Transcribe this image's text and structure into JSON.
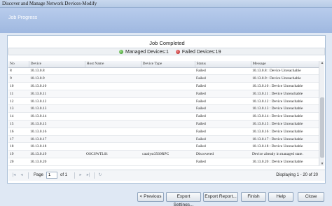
{
  "window": {
    "title": "Discover and Manage Network Devices-Modify"
  },
  "header": {
    "title": "Job Progress"
  },
  "job": {
    "status": "Job Completed",
    "managed_label": "Managed Devices:1",
    "failed_label": "Failed Devices:19",
    "colors": {
      "managed": "#2d8a1e",
      "failed": "#b01818"
    }
  },
  "grid": {
    "columns": [
      "No",
      "Device",
      "Host Name",
      "Device Type",
      "Status",
      "Message"
    ],
    "rows": [
      {
        "no": "8",
        "device": "10.13.0.8",
        "host": "",
        "type": "",
        "status": "Failed",
        "message": "10.13.0.8 : Device Unreachable"
      },
      {
        "no": "9",
        "device": "10.13.0.9",
        "host": "",
        "type": "",
        "status": "Failed",
        "message": "10.13.0.9 : Device Unreachable"
      },
      {
        "no": "10",
        "device": "10.13.0.10",
        "host": "",
        "type": "",
        "status": "Failed",
        "message": "10.13.0.10 : Device Unreachable"
      },
      {
        "no": "11",
        "device": "10.13.0.11",
        "host": "",
        "type": "",
        "status": "Failed",
        "message": "10.13.0.11 : Device Unreachable"
      },
      {
        "no": "12",
        "device": "10.13.0.12",
        "host": "",
        "type": "",
        "status": "Failed",
        "message": "10.13.0.12 : Device Unreachable"
      },
      {
        "no": "13",
        "device": "10.13.0.13",
        "host": "",
        "type": "",
        "status": "Failed",
        "message": "10.13.0.13 : Device Unreachable"
      },
      {
        "no": "14",
        "device": "10.13.0.14",
        "host": "",
        "type": "",
        "status": "Failed",
        "message": "10.13.0.14 : Device Unreachable"
      },
      {
        "no": "15",
        "device": "10.13.0.15",
        "host": "",
        "type": "",
        "status": "Failed",
        "message": "10.13.0.15 : Device Unreachable"
      },
      {
        "no": "16",
        "device": "10.13.0.16",
        "host": "",
        "type": "",
        "status": "Failed",
        "message": "10.13.0.16 : Device Unreachable"
      },
      {
        "no": "17",
        "device": "10.13.0.17",
        "host": "",
        "type": "",
        "status": "Failed",
        "message": "10.13.0.17 : Device Unreachable"
      },
      {
        "no": "18",
        "device": "10.13.0.18",
        "host": "",
        "type": "",
        "status": "Failed",
        "message": "10.13.0.18 : Device Unreachable"
      },
      {
        "no": "19",
        "device": "10.13.0.19",
        "host": "OSCSWTL01",
        "type": "catalyst3560RPC",
        "status": "Discovered",
        "message": "Device already in managed state."
      },
      {
        "no": "20",
        "device": "10.13.0.20",
        "host": "",
        "type": "",
        "status": "Failed",
        "message": "10.13.0.20 : Device Unreachable"
      }
    ]
  },
  "pager": {
    "first_icon": "first-page-icon",
    "prev_icon": "prev-page-icon",
    "next_icon": "next-page-icon",
    "last_icon": "last-page-icon",
    "refresh_icon": "refresh-icon",
    "page_label": "Page",
    "page_value": "1",
    "of_label": "of 1",
    "display_text": "Displaying 1 - 20 of 20"
  },
  "buttons": {
    "previous": "< Previous",
    "export_settings": "Export Settings...",
    "export_report": "Export Report...",
    "finish": "Finish",
    "help": "Help",
    "close": "Close"
  }
}
